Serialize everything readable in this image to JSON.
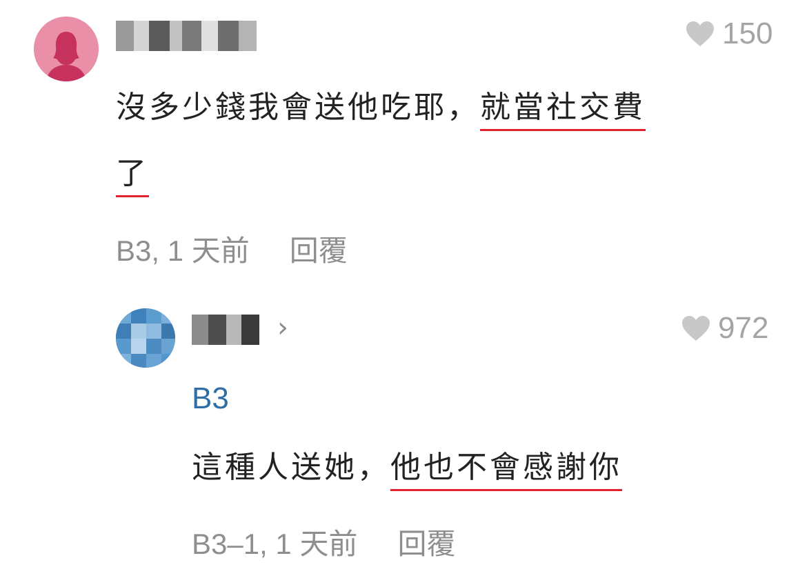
{
  "comments": [
    {
      "likes": "150",
      "text_plain": "沒多少錢我會送他吃耶，",
      "text_highlight_1": "就當社交費",
      "text_highlight_2": "了",
      "meta_floor_time": "B3, 1 天前",
      "reply_label": "回覆",
      "avatar_color": "#e98fa8"
    },
    {
      "likes": "972",
      "floor_ref": "B3",
      "text_plain": "這種人送她，",
      "text_highlight": "他也不會感謝你",
      "meta_floor_time": "B3–1, 1 天前",
      "reply_label": "回覆",
      "chevron": "›",
      "avatar_color": "#4f93c8"
    }
  ],
  "colors": {
    "highlight_underline": "#e0232e",
    "floor_ref": "#2f6fa6",
    "meta_text": "#8e8e8e",
    "like_icon": "#c8c8c8"
  }
}
